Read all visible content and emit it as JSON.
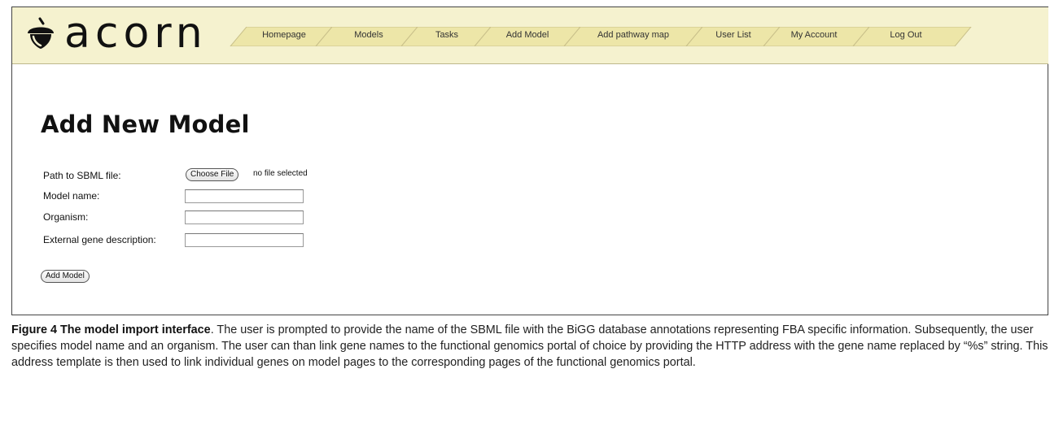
{
  "app": {
    "logo_text": "acorn"
  },
  "nav": {
    "items": [
      {
        "label": "Homepage"
      },
      {
        "label": "Models"
      },
      {
        "label": "Tasks"
      },
      {
        "label": "Add Model"
      },
      {
        "label": "Add pathway map"
      },
      {
        "label": "User List"
      },
      {
        "label": "My Account"
      },
      {
        "label": "Log Out"
      }
    ]
  },
  "colors": {
    "header_bg": "#f5f2cf",
    "tab_bg": "#ede6a8",
    "tab_border": "#c9c08a"
  },
  "page": {
    "title": "Add New Model"
  },
  "form": {
    "sbml_label": "Path to SBML file:",
    "choose_file_label": "Choose File",
    "no_file_text": "no file selected",
    "model_name_label": "Model name:",
    "model_name_value": "",
    "organism_label": "Organism:",
    "organism_value": "",
    "gene_desc_label": "External gene description:",
    "gene_desc_value": "",
    "submit_label": "Add Model"
  },
  "caption": {
    "title": "Figure 4 The model import interface",
    "text": ". The user is prompted to provide the name of the SBML file with the BiGG database annotations representing FBA specific information. Subsequently, the user specifies model name and an organism. The user can than link gene names to the functional genomics portal of choice by providing the HTTP address with the gene name replaced by “%s” string. This address template is then used to link individual genes on model pages to the corresponding pages of the functional genomics portal."
  }
}
